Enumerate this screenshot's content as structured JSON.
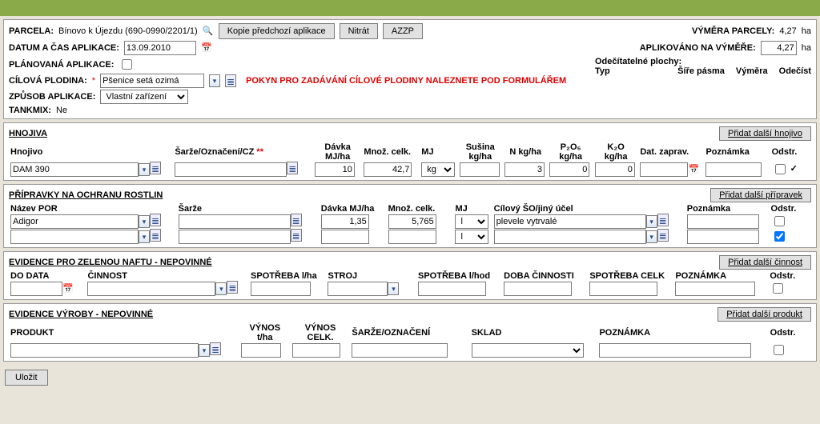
{
  "header": {
    "parcela_label": "PARCELA:",
    "parcela_value": "Bínovo k Újezdu (690-0990/2201/1)",
    "kopie_btn": "Kopie předchozí aplikace",
    "nitrat_btn": "Nitrát",
    "azzp_btn": "AZZP",
    "vymera_label": "VÝMĚRA PARCELY:",
    "vymera_value": "4,27",
    "ha": "ha",
    "datum_label": "DATUM A ČAS APLIKACE:",
    "datum_value": "13.09.2010",
    "aplik_label": "APLIKOVÁNO NA VÝMĚŘE:",
    "aplik_value": "4,27",
    "planovana_label": "PLÁNOVANÁ APLIKACE:",
    "odecit_label": "Odečítatelné plochy:",
    "odecit_typ": "Typ",
    "odecit_sire": "Šíře pásma",
    "odecit_vymera": "Výměra",
    "odecit_odecist": "Odečíst",
    "cilova_label": "CÍLOVÁ PLODINA:",
    "cilova_value": "Pšenice setá ozimá",
    "pokyn_text": "POKYN PRO ZADÁVÁNÍ CÍLOVÉ PLODINY NALEZNETE POD FORMULÁŘEM",
    "zpusob_label": "ZPŮSOB APLIKACE:",
    "zpusob_value": "Vlastní zařízení",
    "tankmix_label": "TANKMIX:",
    "tankmix_value": "Ne"
  },
  "hnojiva": {
    "title": "HNOJIVA",
    "add_btn": "Přidat další hnojivo",
    "cols": {
      "hnojivo": "Hnojivo",
      "sarze": "Šarže/Označení/CZ",
      "sarze_star": "**",
      "davka": "Dávka MJ/ha",
      "mnozcelk": "Množ. celk.",
      "mj": "MJ",
      "susina": "Sušina kg/ha",
      "n": "N kg/ha",
      "p2o5": "P₂O₅ kg/ha",
      "k2o": "K₂O kg/ha",
      "dat": "Dat. zaprav.",
      "pozn": "Poznámka",
      "odstr": "Odstr."
    },
    "row": {
      "hnojivo": "DAM 390",
      "sarze": "",
      "davka": "10",
      "mnozcelk": "42,7",
      "mj": "kg",
      "susina": "",
      "n": "3",
      "p2o5": "0",
      "k2o": "0",
      "dat": "",
      "pozn": ""
    }
  },
  "por": {
    "title": "PŘÍPRAVKY NA OCHRANU ROSTLIN",
    "add_btn": "Přidat další přípravek",
    "cols": {
      "nazev": "Název POR",
      "sarze": "Šarže",
      "davka": "Dávka MJ/ha",
      "mnozcelk": "Množ. celk.",
      "mj": "MJ",
      "cilovy": "Cílový ŠO/jiný účel",
      "pozn": "Poznámka",
      "odstr": "Odstr."
    },
    "rows": [
      {
        "nazev": "Adigor",
        "sarze": "",
        "davka": "1,35",
        "mnozcelk": "5,765",
        "mj": "l",
        "cilovy": "plevele vytrvalé",
        "pozn": "",
        "odstr": false
      },
      {
        "nazev": "",
        "sarze": "",
        "davka": "",
        "mnozcelk": "",
        "mj": "l",
        "cilovy": "",
        "pozn": "",
        "odstr": true
      }
    ]
  },
  "nafta": {
    "title": "EVIDENCE PRO ZELENOU NAFTU - NEPOVINNÉ",
    "add_btn": "Přidat další činnost",
    "cols": {
      "dodata": "DO DATA",
      "cinnost": "ČINNOST",
      "spotrebalha": "SPOTŘEBA l/ha",
      "stroj": "STROJ",
      "spotrebalhod": "SPOTŘEBA l/hod",
      "doba": "DOBA ČINNOSTI",
      "spotrebacelk": "SPOTŘEBA CELK",
      "pozn": "POZNÁMKA",
      "odstr": "Odstr."
    }
  },
  "vyroba": {
    "title": "EVIDENCE VÝROBY - NEPOVINNÉ",
    "add_btn": "Přidat další produkt",
    "cols": {
      "produkt": "PRODUKT",
      "vynostha": "VÝNOS t/ha",
      "vynoscelk": "VÝNOS CELK.",
      "sarze": "ŠARŽE/OZNAČENÍ",
      "sklad": "SKLAD",
      "pozn": "POZNÁMKA",
      "odstr": "Odstr."
    }
  },
  "footer": {
    "save": "Uložit"
  }
}
